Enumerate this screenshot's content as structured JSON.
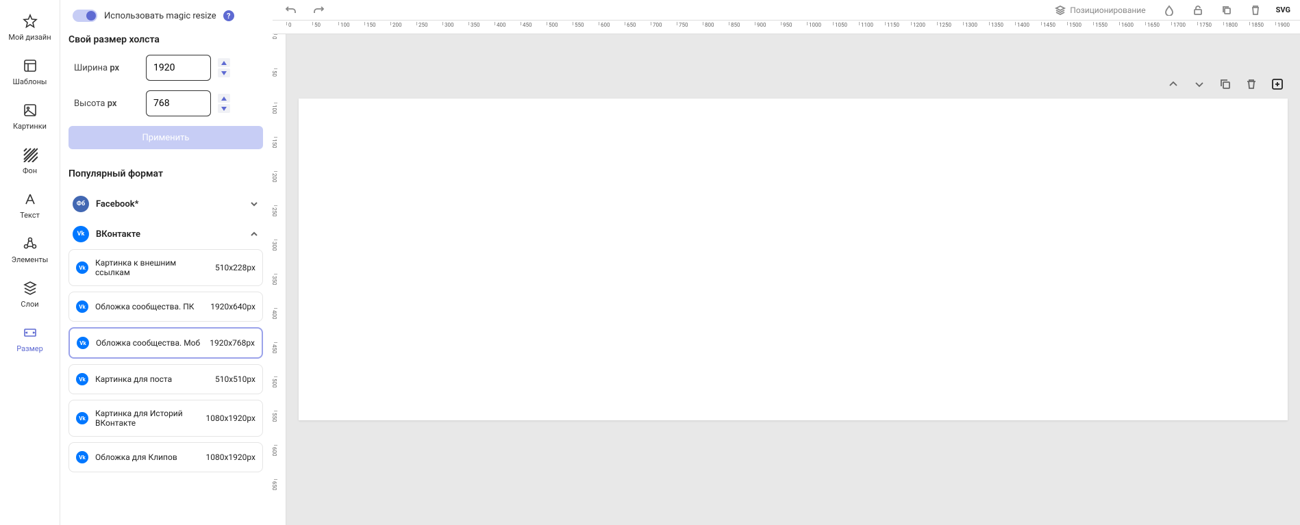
{
  "nav": {
    "items": [
      {
        "label": "Мой дизайн"
      },
      {
        "label": "Шаблоны"
      },
      {
        "label": "Картинки"
      },
      {
        "label": "Фон"
      },
      {
        "label": "Текст"
      },
      {
        "label": "Элементы"
      },
      {
        "label": "Слои"
      },
      {
        "label": "Размер"
      }
    ]
  },
  "panel": {
    "magic_resize_label": "Использовать magic resize",
    "custom_size_heading": "Свой размер холста",
    "width_label": "Ширина ",
    "width_unit": "px",
    "height_label": "Высота ",
    "height_unit": "px",
    "width_value": "1920",
    "height_value": "768",
    "apply_label": "Применить",
    "popular_heading": "Популярный формат",
    "facebook_label": "Facebook*",
    "vk_label": "ВКонтакте",
    "presets": [
      {
        "name": "Картинка к внешним ссылкам",
        "size": "510x228px"
      },
      {
        "name": "Обложка сообщества. ПК",
        "size": "1920x640px"
      },
      {
        "name": "Обложка сообщества. Моб",
        "size": "1920x768px"
      },
      {
        "name": "Картинка для поста",
        "size": "510x510px"
      },
      {
        "name": "Картинка для Историй ВКонтакте",
        "size": "1080x1920px"
      },
      {
        "name": "Обложка для Клипов",
        "size": "1080x1920px"
      }
    ]
  },
  "toolbar": {
    "positioning": "Позиционирование",
    "svg": "SVG"
  },
  "ruler_ticks": [
    0,
    50,
    100,
    150,
    200,
    250,
    300,
    350,
    400,
    450,
    500,
    550,
    600,
    650,
    700,
    750,
    800,
    850,
    900,
    950,
    1000,
    1050,
    1100,
    1150,
    1200,
    1250,
    1300,
    1350,
    1400,
    1450,
    1500,
    1550,
    1600,
    1650,
    1700,
    1750,
    1800,
    1850,
    1900
  ],
  "ruler_v_ticks": [
    0,
    50,
    100,
    150,
    200,
    250,
    300,
    350,
    400,
    450,
    500,
    550,
    600,
    650
  ]
}
